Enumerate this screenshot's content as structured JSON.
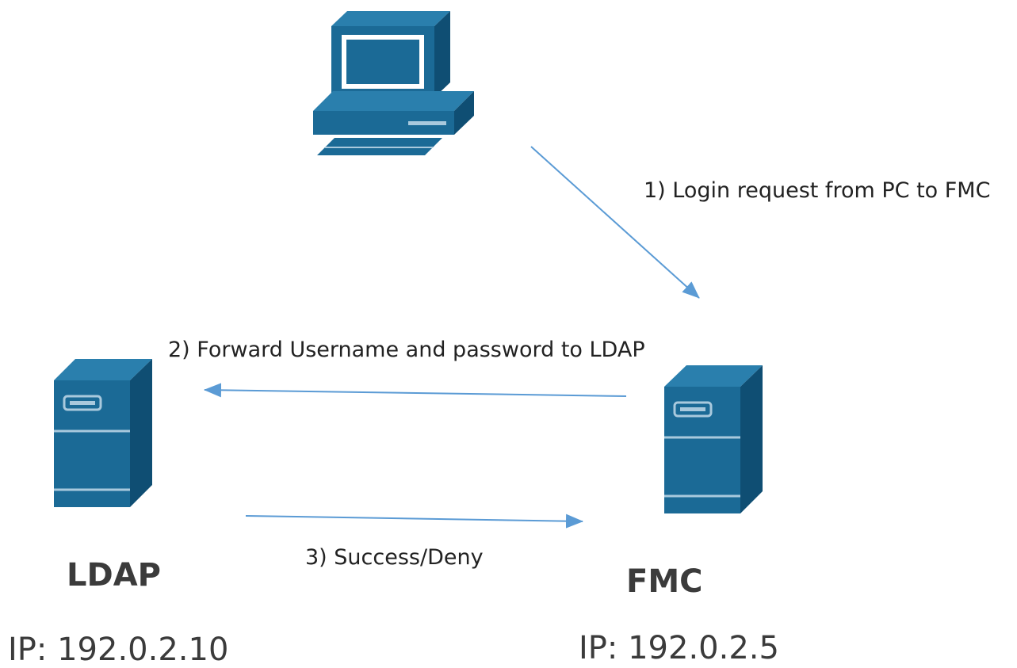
{
  "nodes": {
    "pc": {
      "icon": "desktop-computer-icon"
    },
    "ldap": {
      "icon": "server-tower-icon",
      "name": "LDAP",
      "ip": "IP: 192.0.2.10"
    },
    "fmc": {
      "icon": "server-tower-icon",
      "name": "FMC",
      "ip": "IP: 192.0.2.5"
    }
  },
  "steps": [
    {
      "label": "1) Login request from PC to FMC",
      "from": "pc",
      "to": "fmc"
    },
    {
      "label": "2) Forward Username and password to LDAP",
      "from": "fmc",
      "to": "ldap"
    },
    {
      "label": "3) Success/Deny",
      "from": "ldap",
      "to": "fmc"
    }
  ],
  "colors": {
    "icon_fill": "#1b6a96",
    "icon_shade": "#0f4e73",
    "icon_light": "#a9c9dd",
    "arrow": "#5b9bd5"
  }
}
